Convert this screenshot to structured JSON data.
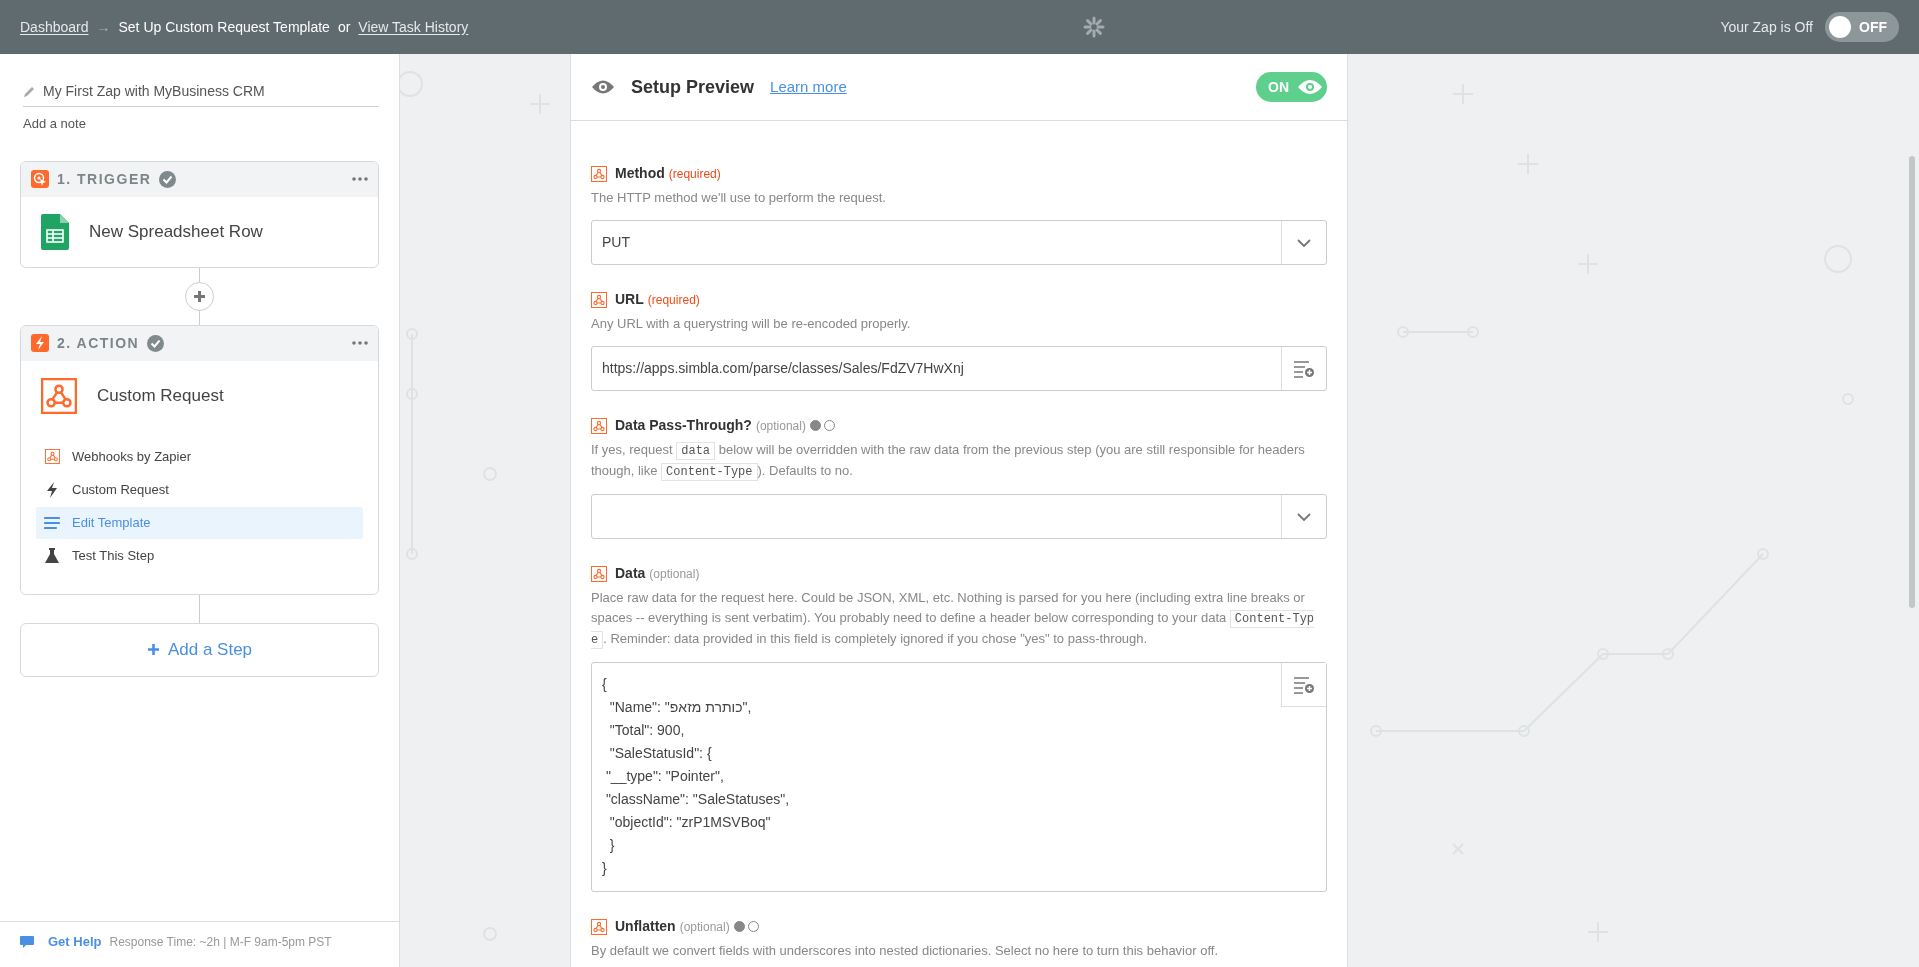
{
  "top_bar": {
    "dashboard_link": "Dashboard",
    "arrow": "→",
    "current_page": "Set Up Custom Request Template",
    "or": "or",
    "history_link": "View Task History",
    "zap_status": "Your Zap is Off",
    "toggle": {
      "label": "OFF",
      "on": false
    }
  },
  "sidebar": {
    "zap_name": "My First Zap with MyBusiness CRM",
    "add_note": "Add a note",
    "steps": [
      {
        "kind": "trigger",
        "header": "1. TRIGGER",
        "completed": true,
        "title": "New Spreadsheet Row"
      },
      {
        "kind": "action",
        "header": "2. ACTION",
        "completed": true,
        "title": "Custom Request",
        "substeps": [
          {
            "kind": "app",
            "label": "Webhooks by Zapier",
            "selected": false
          },
          {
            "kind": "event",
            "label": "Custom Request",
            "selected": false
          },
          {
            "kind": "template",
            "label": "Edit Template",
            "selected": true
          },
          {
            "kind": "test",
            "label": "Test This Step",
            "selected": false
          }
        ]
      }
    ],
    "add_step": "Add a Step",
    "help": {
      "link": "Get Help",
      "info": "Response Time: ~2h | M-F 9am-5pm PST"
    }
  },
  "preview": {
    "title": "Setup Preview",
    "learn_more": "Learn more",
    "toggle": {
      "label": "ON",
      "on": true
    }
  },
  "fields": [
    {
      "kind": "select",
      "label": "Method",
      "tag": "(required)",
      "required": true,
      "help": [
        {
          "kind": "text",
          "text": "The HTTP method we'll use to perform the request."
        }
      ],
      "value": "PUT"
    },
    {
      "kind": "text",
      "label": "URL",
      "tag": "(required)",
      "required": true,
      "help": [
        {
          "kind": "text",
          "text": "Any URL with a querystring will be re-encoded properly."
        }
      ],
      "value": "https://apps.simbla.com/parse/classes/Sales/FdZV7HwXnj"
    },
    {
      "kind": "select",
      "label": "Data Pass-Through?",
      "tag": "(optional)",
      "required": false,
      "radios": [
        {
          "selected": true
        },
        {
          "selected": false
        }
      ],
      "help": [
        {
          "kind": "text",
          "text": "If yes, request "
        },
        {
          "kind": "code",
          "text": "data"
        },
        {
          "kind": "text",
          "text": " below will be overridden with the raw data from the previous step (you are still responsible for headers though, like "
        },
        {
          "kind": "code",
          "text": "Content-Type"
        },
        {
          "kind": "text",
          "text": "). Defaults to no."
        }
      ]
    },
    {
      "kind": "textarea",
      "label": "Data",
      "tag": "(optional)",
      "required": false,
      "help": [
        {
          "kind": "text",
          "text": "Place raw data for the request here. Could be JSON, XML, etc. Nothing is parsed for you here (including extra line breaks or spaces -- everything is sent verbatim). You probably need to define a header below corresponding to your data "
        },
        {
          "kind": "code",
          "text": "Content-Type"
        },
        {
          "kind": "text",
          "text": ". Reminder: data provided in this field is completely ignored if you chose \"yes\" to pass-through."
        }
      ],
      "lines": [
        "{",
        "  \"Name\": \"כותרת מזאפ\",",
        "  \"Total\": 900,",
        "  \"SaleStatusId\": {",
        " \"__type\": \"Pointer\",",
        " \"className\": \"SaleStatuses\",",
        "  \"objectId\": \"zrP1MSVBoq\"",
        "  }",
        "}"
      ]
    },
    {
      "kind": "heading",
      "label": "Unflatten",
      "tag": "(optional)",
      "required": false,
      "radios": [
        {
          "selected": true
        },
        {
          "selected": false
        }
      ],
      "help": [
        {
          "kind": "text",
          "text": "By default we convert fields with underscores into nested dictionaries. Select no here to turn this behavior off."
        }
      ]
    }
  ]
}
